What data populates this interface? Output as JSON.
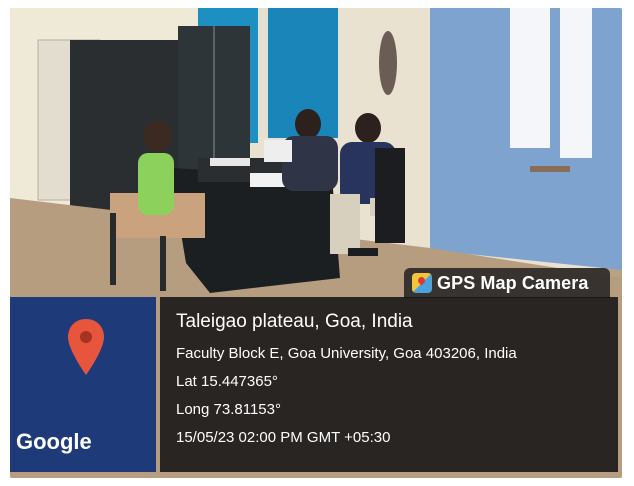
{
  "overlay": {
    "badge_label": "GPS Map Camera",
    "map_brand": "Google",
    "address_title": "Taleigao plateau, Goa, India",
    "address_full": "Faculty Block E, Goa University, Goa 403206, India",
    "latitude": "Lat 15.447365°",
    "longitude": "Long 73.81153°",
    "timestamp": "15/05/23 02:00 PM GMT +05:30"
  },
  "icons": {
    "badge": "gps-map-camera-icon",
    "pin": "map-pin-icon"
  },
  "colors": {
    "map_background": "#1f3a78",
    "pin": "#e8553d",
    "panel": "#101214"
  }
}
